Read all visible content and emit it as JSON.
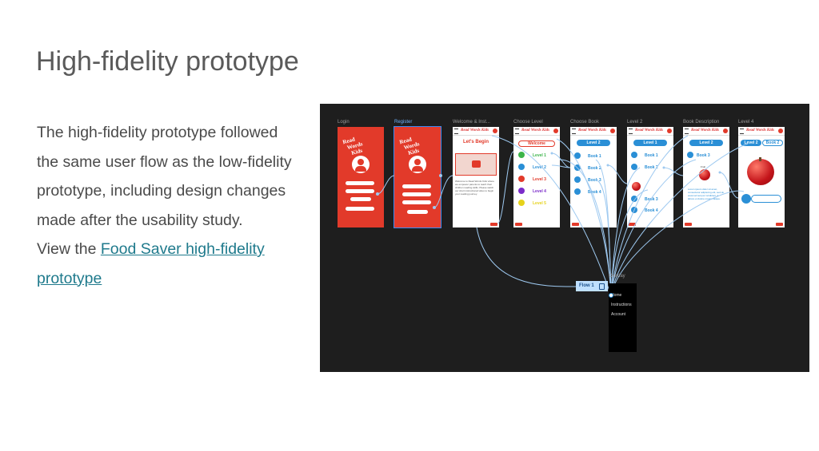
{
  "slide": {
    "title": "High-fidelity prototype",
    "paragraph": "The high-fidelity prototype followed the same user flow as the low-fidelity prototype, including design changes made after the usability study.",
    "view_prefix": "View the ",
    "link_text": "Food Saver high-fidelity prototype"
  },
  "prototype": {
    "frame_labels": [
      "Login",
      "Register",
      "Welcome & Inst...",
      "Choose Level",
      "Choose Book",
      "Level 2",
      "Book Description",
      "Level 4"
    ],
    "logo_lines": [
      "Read",
      "Words",
      "Kids"
    ],
    "app_title": "Read Words Kids",
    "welcome": {
      "heading": "Let's Begin",
      "text": "Welcome to Read Words Kids where we empower parents to teach their children reading skills. Please watch our short instructional video to begin your reading journey."
    },
    "choose_level": {
      "heading": "Welcome",
      "levels": [
        "Level 1",
        "Level 2",
        "Level 3",
        "Level 4",
        "Level 5"
      ],
      "colors": [
        "#3bb44a",
        "#2a8fd6",
        "#e23a2a",
        "#7b2cc9",
        "#e6d21a"
      ]
    },
    "choose_book": {
      "heading": "Level 2",
      "books": [
        "Book 1",
        "Book 2",
        "Book 3",
        "Book 4"
      ]
    },
    "level2": {
      "heading": "Level 1",
      "books": [
        "Book 1",
        "Book 2",
        "Book 3",
        "Book 4"
      ]
    },
    "book_description": {
      "heading": "Level 2",
      "book": "Book 3",
      "fruit": "Fruit",
      "text": "Lorem ipsum dolor sit amet, consectetur adipiscing elit, sed do eiusmod tempor incididunt ut labore et dolore magna aliqua."
    },
    "level4": {
      "heading": "Level 2",
      "book": "Book 2"
    },
    "flow_label": "Flow 1",
    "overlay_label": "Overlay",
    "overlay_items": [
      "Home",
      "Instructions",
      "Account"
    ]
  }
}
